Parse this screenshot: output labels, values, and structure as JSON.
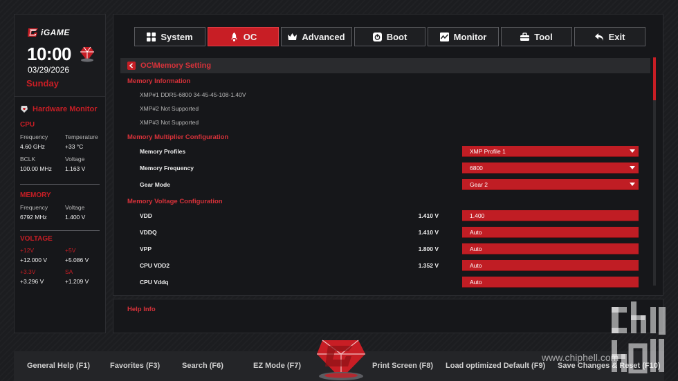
{
  "brand": {
    "name": "iGAME"
  },
  "clock": {
    "time": "10:00",
    "date": "03/29/2026",
    "weekday": "Sunday"
  },
  "hardware_monitor": {
    "title": "Hardware Monitor",
    "cpu": {
      "label": "CPU",
      "frequency_label": "Frequency",
      "frequency": "4.60 GHz",
      "temperature_label": "Temperature",
      "temperature": "+33 °C",
      "bclk_label": "BCLK",
      "bclk": "100.00 MHz",
      "voltage_label": "Voltage",
      "voltage": "1.163 V"
    },
    "memory": {
      "label": "MEMORY",
      "frequency_label": "Frequency",
      "frequency": "6792 MHz",
      "voltage_label": "Voltage",
      "voltage": "1.400 V"
    },
    "voltage": {
      "label": "VOLTAGE",
      "v12_label": "+12V",
      "v12": "+12.000 V",
      "v5_label": "+5V",
      "v5": "+5.086 V",
      "v33_label": "+3.3V",
      "v33": "+3.296 V",
      "sa_label": "SA",
      "sa": "+1.209 V"
    }
  },
  "tabs": [
    {
      "label": "System",
      "icon": "grid-icon",
      "active": false
    },
    {
      "label": "OC",
      "icon": "rocket-icon",
      "active": true
    },
    {
      "label": "Advanced",
      "icon": "crown-icon",
      "active": false
    },
    {
      "label": "Boot",
      "icon": "power-icon",
      "active": false
    },
    {
      "label": "Monitor",
      "icon": "chart-icon",
      "active": false
    },
    {
      "label": "Tool",
      "icon": "toolbox-icon",
      "active": false
    },
    {
      "label": "Exit",
      "icon": "back-arrow-icon",
      "active": false
    }
  ],
  "breadcrumb": "OC\\Memory Setting",
  "sections": {
    "memory_information": {
      "title": "Memory Information",
      "items": [
        "XMP#1 DDR5-6800 34-45-45-108-1.40V",
        "XMP#2 Not Supported",
        "XMP#3 Not Supported"
      ]
    },
    "multiplier": {
      "title": "Memory Multiplier Configuration",
      "rows": [
        {
          "label": "Memory Profiles",
          "value": "XMP Profile 1"
        },
        {
          "label": "Memory Frequency",
          "value": "6800"
        },
        {
          "label": "Gear Mode",
          "value": "Gear 2"
        }
      ]
    },
    "voltage": {
      "title": "Memory Voltage Configuration",
      "rows": [
        {
          "label": "VDD",
          "current": "1.410 V",
          "value": "1.400"
        },
        {
          "label": "VDDQ",
          "current": "1.410 V",
          "value": "Auto"
        },
        {
          "label": "VPP",
          "current": "1.800 V",
          "value": "Auto"
        },
        {
          "label": "CPU VDD2",
          "current": "1.352 V",
          "value": "Auto"
        },
        {
          "label": "CPU Vddq",
          "current": "",
          "value": "Auto"
        }
      ]
    }
  },
  "help": {
    "title": "Help Info"
  },
  "footer": {
    "general_help": "General Help (F1)",
    "favorites": "Favorites (F3)",
    "search": "Search (F6)",
    "ez_mode": "EZ Mode (F7)",
    "print_screen": "Print Screen (F8)",
    "load_default": "Load optimized Default (F9)",
    "save_reset": "Save Changes & Reset (F10)"
  },
  "watermark": {
    "url": "www.chiphell.com"
  },
  "colors": {
    "accent": "#c81e25",
    "panel": "#16171a",
    "background": "#1c1d20"
  }
}
